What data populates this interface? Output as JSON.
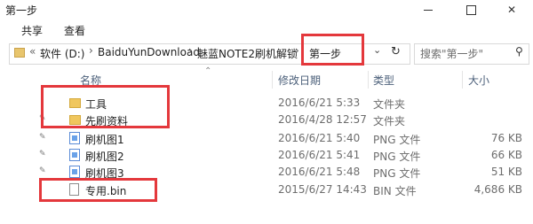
{
  "window": {
    "title": "第一步"
  },
  "ribbon": {
    "tabs": [
      "共享",
      "查看"
    ]
  },
  "address": {
    "more": "«",
    "crumbs": [
      "软件 (D:)",
      "BaiduYunDownload",
      "魅蓝NOTE2刷机解锁",
      "第一步"
    ],
    "separator": "›"
  },
  "search": {
    "placeholder": "搜索\"第一步\""
  },
  "columns": {
    "name": "名称",
    "date": "修改日期",
    "type": "类型",
    "size": "大小"
  },
  "files": [
    {
      "name": "工具",
      "date": "2016/6/21 5:33",
      "type": "文件夹",
      "size": "",
      "icon": "folder-icon"
    },
    {
      "name": "先刷资料",
      "date": "2016/4/28 12:57",
      "type": "文件夹",
      "size": "",
      "icon": "folder-icon"
    },
    {
      "name": "刷机图1",
      "date": "2016/6/21 5:40",
      "type": "PNG 文件",
      "size": "76 KB",
      "icon": "image-file-icon"
    },
    {
      "name": "刷机图2",
      "date": "2016/6/21 5:41",
      "type": "PNG 文件",
      "size": "66 KB",
      "icon": "image-file-icon"
    },
    {
      "name": "刷机图3",
      "date": "2016/6/21 5:48",
      "type": "PNG 文件",
      "size": "51 KB",
      "icon": "image-file-icon"
    },
    {
      "name": "专用.bin",
      "date": "2015/6/27 14:43",
      "type": "BIN 文件",
      "size": "4,686 KB",
      "icon": "file-icon"
    }
  ],
  "colors": {
    "highlight": "#e4383c",
    "header_text": "#4c607a",
    "folder": "#f0c75e"
  }
}
